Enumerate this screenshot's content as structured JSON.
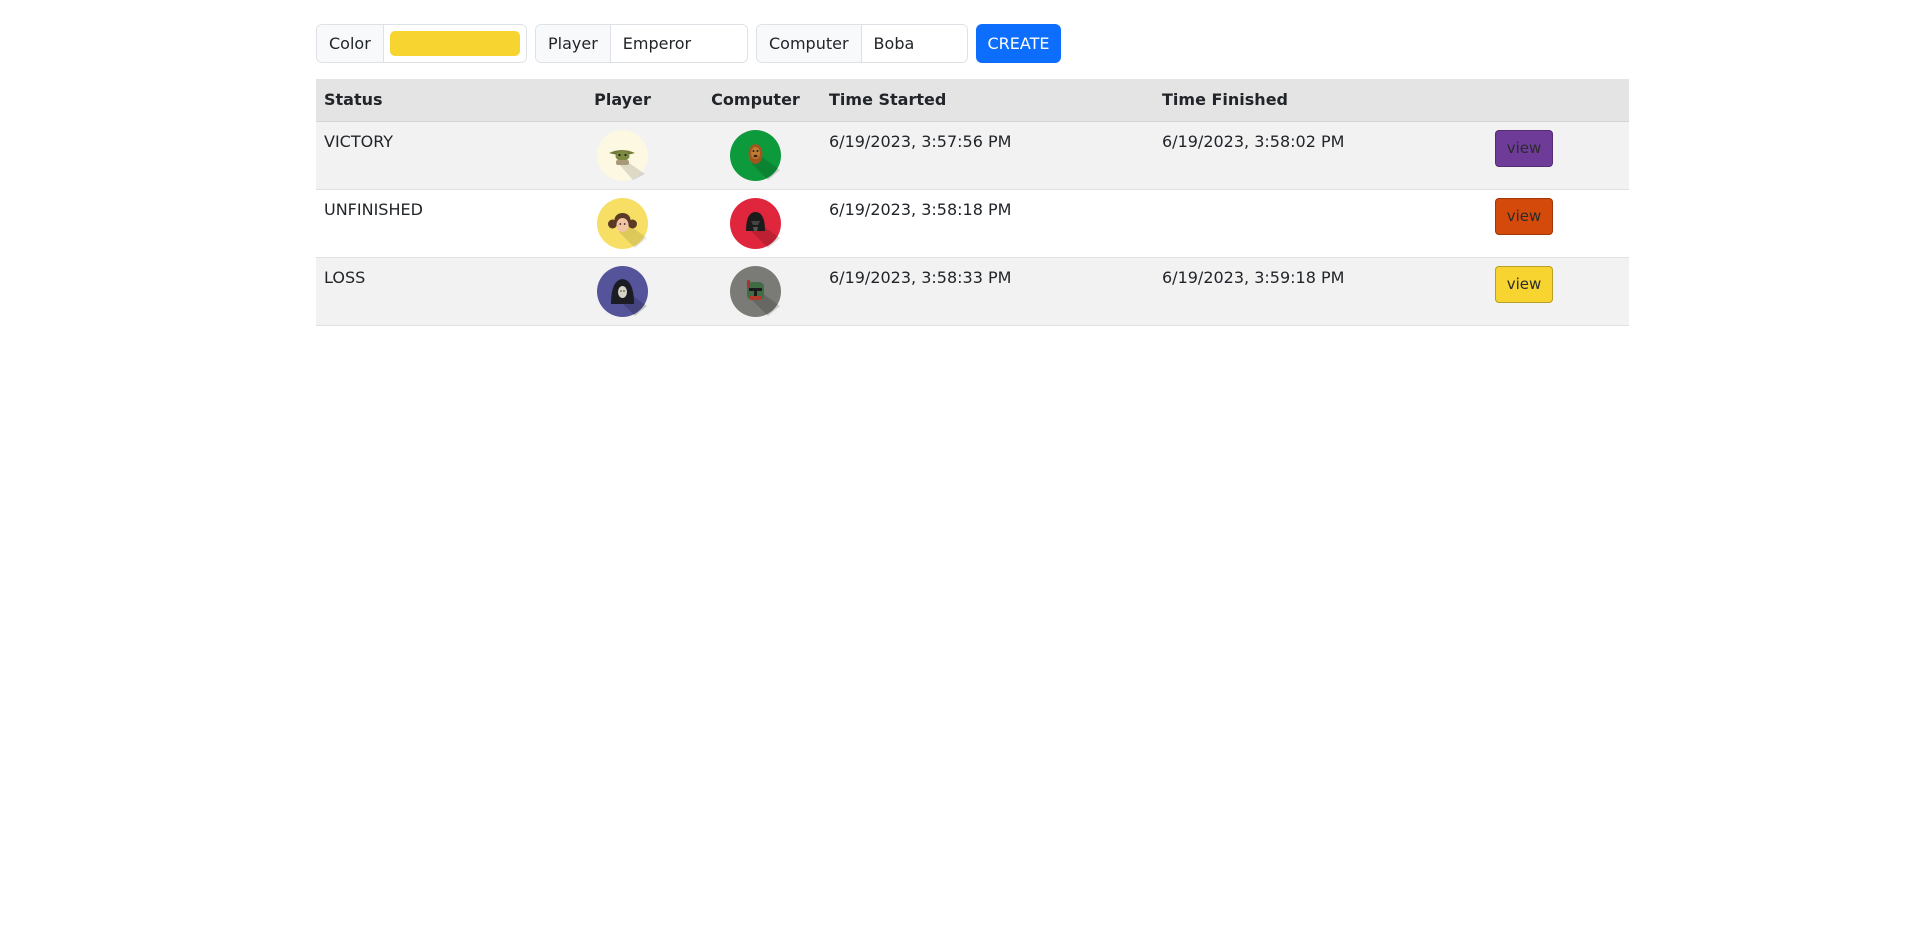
{
  "controls": {
    "color_label": "Color",
    "color_value": "#f7d42f",
    "player_label": "Player",
    "player_value": "Emperor",
    "computer_label": "Computer",
    "computer_value": "Boba",
    "create_label": "CREATE"
  },
  "table": {
    "headers": {
      "status": "Status",
      "player": "Player",
      "computer": "Computer",
      "time_started": "Time Started",
      "time_finished": "Time Finished"
    },
    "rows": [
      {
        "status": "VICTORY",
        "player_icon": "yoda-icon",
        "player_bg": "#fdf8e1",
        "computer_icon": "chewbacca-icon",
        "computer_bg": "#0d9a3d",
        "time_started": "6/19/2023, 3:57:56 PM",
        "time_finished": "6/19/2023, 3:58:02 PM",
        "view_label": "view",
        "view_color": "#6f3b99"
      },
      {
        "status": "UNFINISHED",
        "player_icon": "leia-icon",
        "player_bg": "#f7df65",
        "computer_icon": "darth-vader-icon",
        "computer_bg": "#e0263c",
        "time_started": "6/19/2023, 3:58:18 PM",
        "time_finished": "",
        "view_label": "view",
        "view_color": "#d44a0a"
      },
      {
        "status": "LOSS",
        "player_icon": "emperor-icon",
        "player_bg": "#55549a",
        "computer_icon": "boba-fett-icon",
        "computer_bg": "#7a7a76",
        "time_started": "6/19/2023, 3:58:33 PM",
        "time_finished": "6/19/2023, 3:59:18 PM",
        "view_label": "view",
        "view_color": "#f7d42f"
      }
    ]
  }
}
